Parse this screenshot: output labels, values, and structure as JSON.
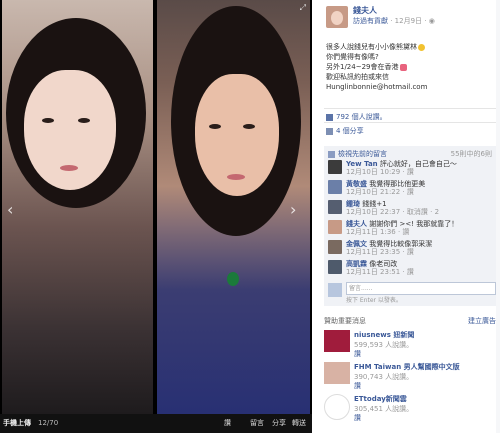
{
  "viewer": {
    "album_label": "手機上傳",
    "counter": "12/70",
    "actions": [
      "讚",
      "留言",
      "分享",
      "轉送",
      "讚"
    ],
    "prev_arrow": "‹",
    "next_arrow": "›",
    "expand": "⤢"
  },
  "author": {
    "name": "錢夫人",
    "via": "訪過有貢獻",
    "date": "· 12月9日 ·"
  },
  "caption": {
    "lines": [
      "很多人說錢兒有小小像熊黛林",
      "你們覺得有像嗎?",
      "另外1/24~29會在香港",
      "歡迎私訊約拍或來信",
      "Hunglinbonnie@hotmail.com"
    ]
  },
  "stats": {
    "likes": "792 個人說讚。",
    "shares": "4 個分享",
    "view_previous": "檢視先前的留言",
    "previous_count": "55則中的6則"
  },
  "comments": [
    {
      "name": "Yew Tan",
      "text": "評心就好，自己會自己～",
      "meta": "12月10日 10:29 · 讚",
      "color": "#3b3b3b"
    },
    {
      "name": "黃敬盛",
      "text": "我覺得那比他更美",
      "meta": "12月10日 21:22 · 讚",
      "color": "#6b7fa8"
    },
    {
      "name": "鍾琦",
      "text": "錢錢+1",
      "meta": "12月10日 22:37 · 取消讚 · 2",
      "color": "#555e70"
    },
    {
      "name": "錢夫人",
      "text": "謝謝你們 ><! 我那就靠了！",
      "meta": "12月11日 1:36 · 讚",
      "color": "#c79a86"
    },
    {
      "name": "金佩文",
      "text": "我覺得比較像郭采潔",
      "meta": "12月11日 23:35 · 讚",
      "color": "#7a6a60"
    },
    {
      "name": "高凱霖",
      "text": "像老司改",
      "meta": "12月11日 23:51 · 讚",
      "color": "#4e5a6b"
    }
  ],
  "comment_input": {
    "placeholder": "留言......",
    "hint": "按下 Enter 以發表。"
  },
  "sponsored": {
    "title": "贊助重要消息",
    "create_link": "建立廣告",
    "items": [
      {
        "name": "niusnews 妞新聞",
        "likes": "599,593 人說讚。",
        "like": "讚",
        "logo": "#a01c3c"
      },
      {
        "name": "FHM Taiwan 男人幫國際中文版",
        "likes": "390,743 人說讚。",
        "like": "讚",
        "logo": "#d8b2a4"
      },
      {
        "name": "ETtoday新聞雲",
        "likes": "305,451 人說讚。",
        "like": "讚",
        "logo": "#2f67b1"
      }
    ]
  }
}
